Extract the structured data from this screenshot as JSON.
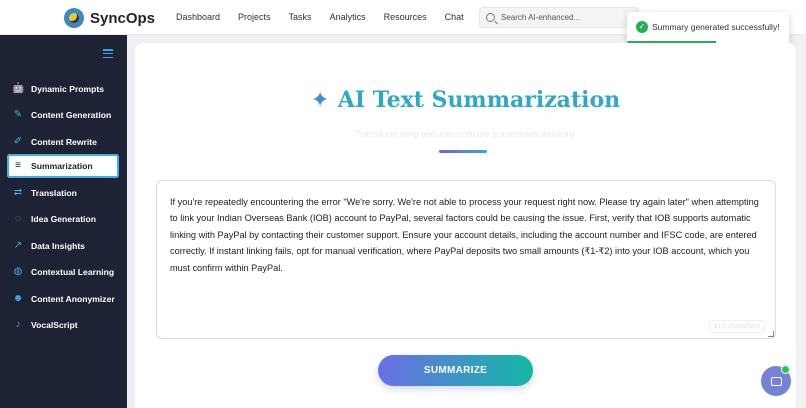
{
  "app": {
    "name": "SyncOps"
  },
  "nav": [
    {
      "label": "Dashboard"
    },
    {
      "label": "Projects"
    },
    {
      "label": "Tasks"
    },
    {
      "label": "Analytics"
    },
    {
      "label": "Resources"
    },
    {
      "label": "Chat"
    }
  ],
  "search": {
    "placeholder": "Search AI-enhanced..."
  },
  "toast": {
    "message": "Summary generated successfully!",
    "icon": "check-icon",
    "color": "#22b14c",
    "progress": 0.55
  },
  "sidebar": {
    "items": [
      {
        "label": "Dynamic Prompts",
        "icon": "robot-icon",
        "glyph": "🤖"
      },
      {
        "label": "Content Generation",
        "icon": "pencil-icon",
        "glyph": "✎"
      },
      {
        "label": "Content Rewrite",
        "icon": "edit-icon",
        "glyph": "✐"
      },
      {
        "label": "Summarization",
        "icon": "summary-icon",
        "glyph": "≡",
        "active": true
      },
      {
        "label": "Translation",
        "icon": "translate-icon",
        "glyph": "⇄"
      },
      {
        "label": "Idea Generation",
        "icon": "lightbulb-icon",
        "glyph": "◌"
      },
      {
        "label": "Data Insights",
        "icon": "chart-icon",
        "glyph": "↗"
      },
      {
        "label": "Contextual Learning",
        "icon": "brain-icon",
        "glyph": "◍"
      },
      {
        "label": "Content Anonymizer",
        "icon": "anonymous-icon",
        "glyph": "☻"
      },
      {
        "label": "VocalScript",
        "icon": "microphone-icon",
        "glyph": "♪"
      }
    ]
  },
  "main": {
    "title": "AI Text Summarization",
    "subtitle": "Transform long text into concise summaries instantly",
    "input_text": "If you're repeatedly encountering the error \"We're sorry. We're not able to process your request right now. Please try again later\" when attempting to link your Indian Overseas Bank (IOB) account to PayPal, several factors could be causing the issue. First, verify that IOB supports automatic linking with PayPal by contacting their customer support. Ensure your account details, including the account number and IFSC code, are entered correctly. If instant linking fails, opt for manual verification, where PayPal deposits two small amounts (₹1-₹2) into your IOB account, which you must confirm within PayPal.",
    "char_count": "610 characters",
    "button_label": "SUMMARIZE"
  },
  "colors": {
    "accent": "#2fa8c8",
    "sidebar_bg": "#1e2235",
    "sidebar_icon": "#3fb0e6"
  }
}
